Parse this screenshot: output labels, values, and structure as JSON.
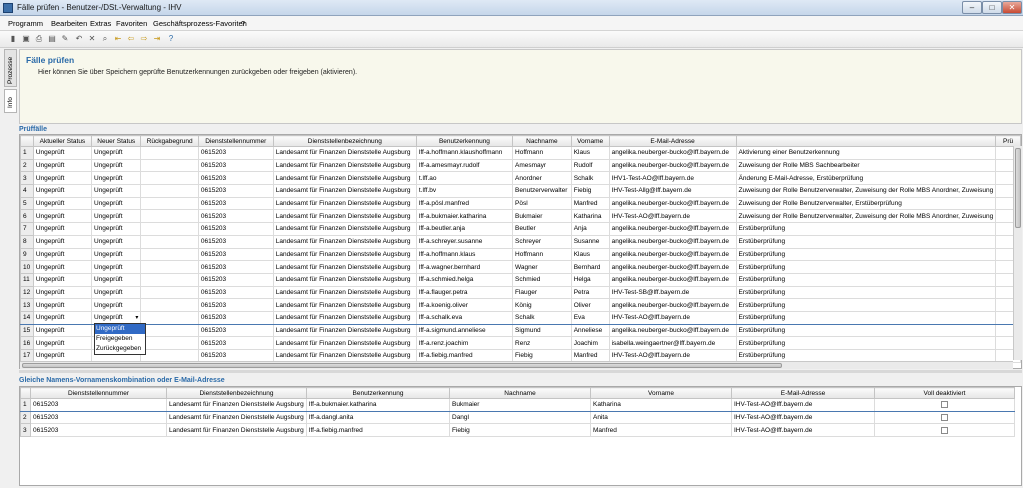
{
  "window": {
    "title": "Fälle prüfen - Benutzer-/DSt.-Verwaltung - IHV"
  },
  "menu": [
    "Programm",
    "Bearbeiten",
    "Extras",
    "Favoriten",
    "Geschäftsprozess-Favoriten",
    "?"
  ],
  "side_tabs": [
    "Prozesse",
    "Info"
  ],
  "panel": {
    "title": "Fälle prüfen",
    "description": "Hier können Sie über Speichern geprüfte Benutzerkennungen zurückgeben oder freigeben (aktivieren)."
  },
  "section1": "Prüffälle",
  "section2": "Gleiche Namens-Vornamenskombination oder E-Mail-Adresse",
  "grid1": {
    "columns": [
      "",
      "Aktueller Status",
      "Neuer Status",
      "Rückgabegrund",
      "Dienststellennummer",
      "Dienststellenbezeichnung",
      "Benutzerkennung",
      "Nachname",
      "Vorname",
      "E-Mail-Adresse",
      "",
      "Prü"
    ],
    "rows": [
      [
        "1",
        "Ungeprüft",
        "Ungeprüft",
        "",
        "0615203",
        "Landesamt für Finanzen Dienststelle Augsburg",
        "lff-a.hoffmann.klaushoffmann",
        "Hoffmann",
        "Klaus",
        "angelika.neuberger-bucko@lff.bayern.de",
        "Aktivierung einer Benutzerkennung"
      ],
      [
        "2",
        "Ungeprüft",
        "Ungeprüft",
        "",
        "0615203",
        "Landesamt für Finanzen Dienststelle Augsburg",
        "lff-a.amesmayr.rudolf",
        "Amesmayr",
        "Rudolf",
        "angelika.neuberger-bucko@lff.bayern.de",
        "Zuweisung der Rolle MBS Sachbearbeiter"
      ],
      [
        "3",
        "Ungeprüft",
        "Ungeprüft",
        "",
        "0615203",
        "Landesamt für Finanzen Dienststelle Augsburg",
        "t.lff.ao",
        "Anordner",
        "Schalk",
        "IHV1-Test-AO@lff.bayern.de",
        "Änderung E-Mail-Adresse, Erstüberprüfung"
      ],
      [
        "4",
        "Ungeprüft",
        "Ungeprüft",
        "",
        "0615203",
        "Landesamt für Finanzen Dienststelle Augsburg",
        "t.lff.bv",
        "Benutzerverwalter",
        "Fiebig",
        "IHV-Test-Allg@lff.bayern.de",
        "Zuweisung der Rolle Benutzerverwalter, Zuweisung der Rolle MBS Anordner, Zuweisung"
      ],
      [
        "5",
        "Ungeprüft",
        "Ungeprüft",
        "",
        "0615203",
        "Landesamt für Finanzen Dienststelle Augsburg",
        "lff-a.pösl.manfred",
        "Pösl",
        "Manfred",
        "angelika.neuberger-bucko@lff.bayern.de",
        "Zuweisung der Rolle Benutzerverwalter, Erstüberprüfung"
      ],
      [
        "6",
        "Ungeprüft",
        "Ungeprüft",
        "",
        "0615203",
        "Landesamt für Finanzen Dienststelle Augsburg",
        "lff-a.bukmaier.katharina",
        "Bukmaier",
        "Katharina",
        "IHV-Test-AO@lff.bayern.de",
        "Zuweisung der Rolle Benutzerverwalter, Zuweisung der Rolle MBS Anordner, Zuweisung"
      ],
      [
        "7",
        "Ungeprüft",
        "Ungeprüft",
        "",
        "0615203",
        "Landesamt für Finanzen Dienststelle Augsburg",
        "lff-a.beutler.anja",
        "Beutler",
        "Anja",
        "angelika.neuberger-bucko@lff.bayern.de",
        "Erstüberprüfung"
      ],
      [
        "8",
        "Ungeprüft",
        "Ungeprüft",
        "",
        "0615203",
        "Landesamt für Finanzen Dienststelle Augsburg",
        "lff-a.schreyer.susanne",
        "Schreyer",
        "Susanne",
        "angelika.neuberger-bucko@lff.bayern.de",
        "Erstüberprüfung"
      ],
      [
        "9",
        "Ungeprüft",
        "Ungeprüft",
        "",
        "0615203",
        "Landesamt für Finanzen Dienststelle Augsburg",
        "lff-a.hoffmann.klaus",
        "Hoffmann",
        "Klaus",
        "angelika.neuberger-bucko@lff.bayern.de",
        "Erstüberprüfung"
      ],
      [
        "10",
        "Ungeprüft",
        "Ungeprüft",
        "",
        "0615203",
        "Landesamt für Finanzen Dienststelle Augsburg",
        "lff-a.wagner.bernhard",
        "Wagner",
        "Bernhard",
        "angelika.neuberger-bucko@lff.bayern.de",
        "Erstüberprüfung"
      ],
      [
        "11",
        "Ungeprüft",
        "Ungeprüft",
        "",
        "0615203",
        "Landesamt für Finanzen Dienststelle Augsburg",
        "lff-a.schmied.helga",
        "Schmied",
        "Helga",
        "angelika.neuberger-bucko@lff.bayern.de",
        "Erstüberprüfung"
      ],
      [
        "12",
        "Ungeprüft",
        "Ungeprüft",
        "",
        "0615203",
        "Landesamt für Finanzen Dienststelle Augsburg",
        "lff-a.flauger.petra",
        "Flauger",
        "Petra",
        "IHV-Test-SB@lff.bayern.de",
        "Erstüberprüfung"
      ],
      [
        "13",
        "Ungeprüft",
        "Ungeprüft",
        "",
        "0615203",
        "Landesamt für Finanzen Dienststelle Augsburg",
        "lff-a.koenig.oliver",
        "König",
        "Oliver",
        "angelika.neuberger-bucko@lff.bayern.de",
        "Erstüberprüfung"
      ],
      [
        "14",
        "Ungeprüft",
        "Ungeprüft",
        "",
        "0615203",
        "Landesamt für Finanzen Dienststelle Augsburg",
        "lff-a.schalk.eva",
        "Schalk",
        "Eva",
        "IHV-Test-AO@lff.bayern.de",
        "Erstüberprüfung"
      ],
      [
        "15",
        "Ungeprüft",
        "",
        "",
        "0615203",
        "Landesamt für Finanzen Dienststelle Augsburg",
        "lff-a.sigmund.anneliese",
        "Sigmund",
        "Anneliese",
        "angelika.neuberger-bucko@lff.bayern.de",
        "Erstüberprüfung"
      ],
      [
        "16",
        "Ungeprüft",
        "",
        "",
        "0615203",
        "Landesamt für Finanzen Dienststelle Augsburg",
        "lff-a.renz.joachim",
        "Renz",
        "Joachim",
        "isabella.weingaertner@lff.bayern.de",
        "Erstüberprüfung"
      ],
      [
        "17",
        "Ungeprüft",
        "",
        "",
        "0615203",
        "Landesamt für Finanzen Dienststelle Augsburg",
        "lff-a.fiebig.manfred",
        "Fiebig",
        "Manfred",
        "IHV-Test-AO@lff.bayern.de",
        "Erstüberprüfung"
      ]
    ],
    "dropdown_options": [
      "Ungeprüft",
      "Freigegeben",
      "Zurückgegeben"
    ]
  },
  "grid2": {
    "columns": [
      "",
      "Dienststellennummer",
      "Dienststellenbezeichnung",
      "Benutzerkennung",
      "Nachname",
      "Vorname",
      "E-Mail-Adresse",
      "Voll deaktiviert"
    ],
    "rows": [
      [
        "1",
        "0615203",
        "Landesamt für Finanzen Dienststelle Augsburg",
        "lff-a.bukmaier.katharina",
        "Bukmaier",
        "Katharina",
        "IHV-Test-AO@lff.bayern.de"
      ],
      [
        "2",
        "0615203",
        "Landesamt für Finanzen Dienststelle Augsburg",
        "lff-a.dangl.anita",
        "Dangl",
        "Anita",
        "IHV-Test-AO@lff.bayern.de"
      ],
      [
        "3",
        "0615203",
        "Landesamt für Finanzen Dienststelle Augsburg",
        "lff-a.fiebig.manfred",
        "Fiebig",
        "Manfred",
        "IHV-Test-AO@lff.bayern.de"
      ]
    ]
  },
  "colors": {
    "accent": "#2a6aa8",
    "selection": "#316ac5"
  }
}
